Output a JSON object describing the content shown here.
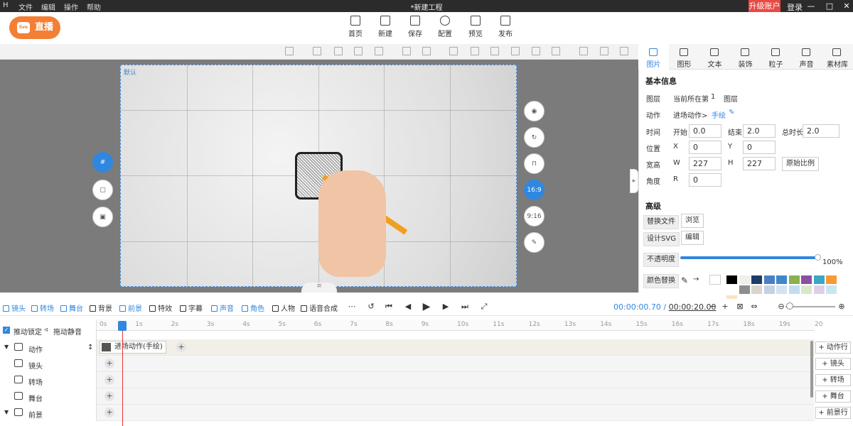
{
  "titlebar": {
    "app_icon": "H",
    "menus": [
      "文件",
      "编辑",
      "操作",
      "帮助"
    ],
    "title": "*新建工程",
    "upgrade": "升级账户",
    "login": "登录",
    "controls": [
      "—",
      "□",
      "✕"
    ]
  },
  "logo": {
    "badge": "live",
    "text": "直播"
  },
  "toolbar": [
    "首页",
    "新建",
    "保存",
    "配置",
    "预览",
    "发布"
  ],
  "canvas": {
    "label": "默认",
    "ratio_16_9": "16:9",
    "ratio_9_16": "9:16"
  },
  "right_tabs": [
    "图片",
    "图形",
    "文本",
    "装饰",
    "粒子",
    "声音",
    "素材库"
  ],
  "basic": {
    "heading": "基本信息",
    "layer_label": "图层",
    "layer_text": "当前所在第",
    "layer_num": "1",
    "layer_suffix": "图层",
    "action_label": "动作",
    "action_value": "进场动作>",
    "action_link": "手绘",
    "time_label": "时间",
    "start_label": "开始",
    "start": "0.0",
    "end_label": "结束",
    "end": "2.0",
    "total_label": "总时长",
    "total": "2.0",
    "pos_label": "位置",
    "x_label": "X",
    "x": "0",
    "y_label": "Y",
    "y": "0",
    "size_label": "宽高",
    "w_label": "W",
    "w": "227",
    "h_label": "H",
    "h": "227",
    "orig_ratio": "原始比例",
    "angle_label": "角度",
    "r_label": "R",
    "r": "0"
  },
  "advanced": {
    "heading": "高级",
    "replace_file": "替换文件",
    "browse": "浏览",
    "design_svg": "设计SVG",
    "edit": "编辑",
    "opacity": "不透明度",
    "opacity_value": "100%",
    "color_replace": "颜色替换"
  },
  "swatches": [
    "#000000",
    "#f0efe9",
    "#1f3c68",
    "#4a7fc5",
    "#3e88c9",
    "#8ab04f",
    "#8a4fa3",
    "#3aa6c8",
    "#f79a35",
    "#ffffff",
    "#8d8d8d",
    "#d9d6cc",
    "#c5d2e4",
    "#d5e2f1",
    "#c3dcf0",
    "#d9e8c8",
    "#e0cfe9",
    "#c7e6f2",
    "#fbe1c2"
  ],
  "bottom_tools": [
    "镜头",
    "转场",
    "舞台",
    "背景",
    "前景",
    "特效",
    "字幕",
    "声音",
    "角色",
    "人物",
    "语音合成"
  ],
  "time": {
    "current": "00:00:00.70",
    "sep": " / ",
    "total": "00:00:20.00"
  },
  "timeline": {
    "lock": "推动锁定",
    "mute": "拖动静音",
    "ticks": [
      "0s",
      "1s",
      "2s",
      "3s",
      "4s",
      "5s",
      "6s",
      "7s",
      "8s",
      "9s",
      "10s",
      "11s",
      "12s",
      "13s",
      "14s",
      "15s",
      "16s",
      "17s",
      "18s",
      "19s",
      "20"
    ],
    "tracks": [
      "动作",
      "镜头",
      "转场",
      "舞台",
      "前景"
    ],
    "clip": "进场动作(手绘)",
    "add_buttons": [
      "+ 动作行",
      "+ 镜头",
      "+ 转场",
      "+ 舞台",
      "+ 前景行"
    ]
  }
}
